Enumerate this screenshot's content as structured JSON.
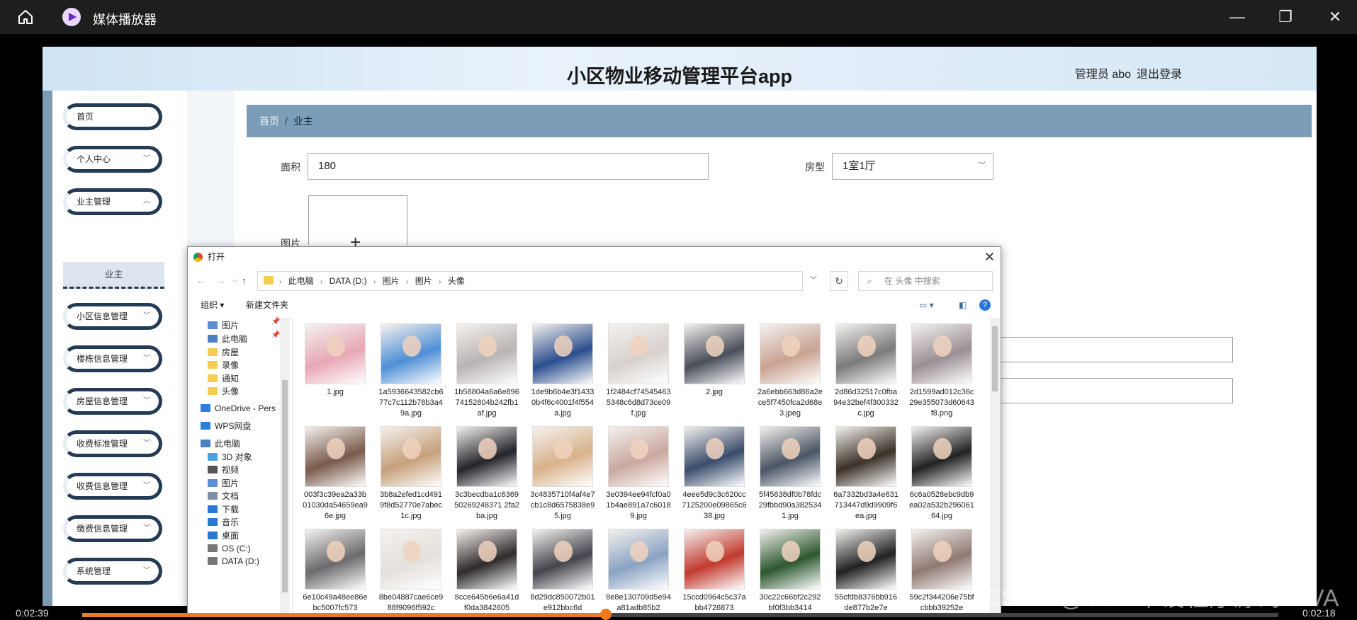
{
  "player": {
    "title": "媒体播放器",
    "time_current": "0:02:39",
    "time_total": "0:02:18",
    "progress_fraction": 0.438,
    "watermark": "CSDN @SSM毕设程序源码JAVA"
  },
  "app": {
    "title": "小区物业移动管理平台app",
    "user": "管理员 abo",
    "logout": "退出登录",
    "nav": [
      {
        "label": "首页",
        "has_chevron": false
      },
      {
        "label": "个人中心",
        "has_chevron": true
      },
      {
        "label": "业主管理",
        "has_chevron": true
      },
      {
        "label": "小区信息管理",
        "has_chevron": true
      },
      {
        "label": "楼栋信息管理",
        "has_chevron": true
      },
      {
        "label": "房屋信息管理",
        "has_chevron": true
      },
      {
        "label": "收费标准管理",
        "has_chevron": true
      },
      {
        "label": "收费信息管理",
        "has_chevron": true
      },
      {
        "label": "缴费信息管理",
        "has_chevron": true
      },
      {
        "label": "系统管理",
        "has_chevron": true
      }
    ],
    "nav_sub": "业主",
    "breadcrumb": {
      "home": "首页",
      "sep": "/",
      "current": "业主"
    },
    "form": {
      "area_label": "面积",
      "area_value": "180",
      "type_label": "房型",
      "type_value": "1室1厅",
      "image_label": "图片"
    }
  },
  "dialog": {
    "title": "打开",
    "path": [
      "此电脑",
      "DATA (D:)",
      "图片",
      "图片",
      "头像"
    ],
    "search_placeholder": "在 头像 中搜索",
    "organize": "组织 ▾",
    "new_folder": "新建文件夹",
    "nav_pane": [
      {
        "label": "图片",
        "indent": 1,
        "icon": "picture",
        "pinned": true
      },
      {
        "label": "此电脑",
        "indent": 1,
        "icon": "pc",
        "pinned": true
      },
      {
        "label": "房屋",
        "indent": 1,
        "icon": "folder"
      },
      {
        "label": "录像",
        "indent": 1,
        "icon": "folder"
      },
      {
        "label": "通知",
        "indent": 1,
        "icon": "folder"
      },
      {
        "label": "头像",
        "indent": 1,
        "icon": "folder"
      },
      {
        "label": "OneDrive - Pers",
        "indent": 0,
        "icon": "cloud"
      },
      {
        "label": "WPS网盘",
        "indent": 0,
        "icon": "cloud"
      },
      {
        "label": "此电脑",
        "indent": 0,
        "icon": "pc"
      },
      {
        "label": "3D 对象",
        "indent": 1,
        "icon": "cube"
      },
      {
        "label": "视频",
        "indent": 1,
        "icon": "video"
      },
      {
        "label": "图片",
        "indent": 1,
        "icon": "picture"
      },
      {
        "label": "文档",
        "indent": 1,
        "icon": "doc"
      },
      {
        "label": "下载",
        "indent": 1,
        "icon": "download"
      },
      {
        "label": "音乐",
        "indent": 1,
        "icon": "music"
      },
      {
        "label": "桌面",
        "indent": 1,
        "icon": "desktop"
      },
      {
        "label": "OS (C:)",
        "indent": 1,
        "icon": "drive"
      },
      {
        "label": "DATA (D:)",
        "indent": 1,
        "icon": "drive"
      }
    ],
    "files": [
      {
        "name": "1.jpg",
        "color": "#e8a7b6"
      },
      {
        "name": "1a5936643582cb677c7c112b78b3a49a.jpg",
        "color": "#4f8fd6"
      },
      {
        "name": "1b58804a6a6e89674152804b242fb1af.jpg",
        "color": "#b9b4b4"
      },
      {
        "name": "1de9b6b4e3f14330b4f6c4001f4f554a.jpg",
        "color": "#2b4f8e"
      },
      {
        "name": "1f2484cf745454635348c6d8d73ce09f.jpg",
        "color": "#d7d2cf"
      },
      {
        "name": "2.jpg",
        "color": "#4a4f5a"
      },
      {
        "name": "2a6ebb663d86a2ece5f7450fca2d68e3.jpeg",
        "color": "#c9a392"
      },
      {
        "name": "2d86d32517c0fba94e32bef4f300332c.jpg",
        "color": "#7b7b7b"
      },
      {
        "name": "2d1599ad012c36c29e355073d60643f8.png",
        "color": "#9a8f96"
      },
      {
        "name": "003f3c39ea2a33b01030da54659ea96e.jpg",
        "color": "#7a5a4c"
      },
      {
        "name": "3b8a2efed1cd4919f8d52770e7abec1c.jpg",
        "color": "#c6a07a"
      },
      {
        "name": "3c3becdba1c636950269248371 2fa2ba.jpg",
        "color": "#23252b"
      },
      {
        "name": "3c4835710f4af4e7cb1c8d6575838e95.jpg",
        "color": "#d8b28a"
      },
      {
        "name": "3e0394ee94fcf0a01b4ae891a7c60189.jpg",
        "color": "#caa8a0"
      },
      {
        "name": "4eee5d9c3c620cc7125200e09865c638.jpg",
        "color": "#3a4c6c"
      },
      {
        "name": "5f45638df0b78fdc29fbbd90a3825341.jpg",
        "color": "#4b5566"
      },
      {
        "name": "6a7332bd3a4e631713447d9d9909f6ea.jpg",
        "color": "#3b3128"
      },
      {
        "name": "6c6a0528ebc9db9ea02a532b29606164.jpg",
        "color": "#222"
      },
      {
        "name": "6e10c49a48ee86ebc5007fc573",
        "color": "#6b6a6c"
      },
      {
        "name": "8be04887cae6ce988f9096f592c",
        "color": "#e4e0dc"
      },
      {
        "name": "8cce645b6e6a41df0da3842605",
        "color": "#2f2b2b"
      },
      {
        "name": "8d29dc850072b01e912bbc6d",
        "color": "#44464d"
      },
      {
        "name": "8e8e130709d5e94a81adb85b2",
        "color": "#8aa3c3"
      },
      {
        "name": "15ccd0964c5c37abb4726873",
        "color": "#c23a2f"
      },
      {
        "name": "30c22c66bf2c292bf0f3bb3414",
        "color": "#2c5830"
      },
      {
        "name": "55cfdb8376bb916de877b2e7e",
        "color": "#222"
      },
      {
        "name": "59c2f344206e75bfcbbb39252e",
        "color": "#8f7a72"
      }
    ]
  }
}
